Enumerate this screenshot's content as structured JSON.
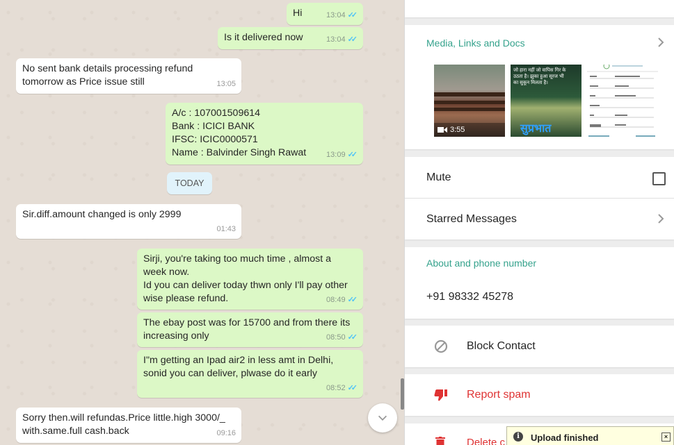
{
  "chat": {
    "messages": [
      {
        "dir": "out",
        "text": "Hi",
        "time": "13:04",
        "read": true
      },
      {
        "dir": "out",
        "text": "Is it delivered now",
        "time": "13:04",
        "read": true
      },
      {
        "dir": "in",
        "text": "No sent bank details processing refund\ntomorrow as Price issue still",
        "time": "13:05"
      },
      {
        "dir": "out",
        "text": "A/c : 107001509614\nBank : ICICI BANK\nIFSC:  ICIC0000571\nName : Balvinder Singh Rawat",
        "time": "13:09",
        "read": true
      },
      {
        "dir": "in",
        "text": "Sir.diff.amount changed is only 2999",
        "time": "01:43"
      },
      {
        "dir": "out",
        "text": "Sirji, you're taking too much time , almost a\nweek now.\nId you can deliver today thwn only I'll pay other\nwise please refund.",
        "time": "08:49",
        "read": true
      },
      {
        "dir": "out",
        "text": "The ebay post was for 15700 and from there its\nincreasing only",
        "time": "08:50",
        "read": true
      },
      {
        "dir": "out",
        "text": "I\"m getting an Ipad air2 in less amt in Delhi,\nsonid you can deliver, plwase do it early",
        "time": "08:52",
        "read": true
      },
      {
        "dir": "in",
        "text": "Sorry then.will refundas.Price little.high 3000/_\nwith.same.full cash.back",
        "time": "09:16"
      }
    ],
    "date_chip": "TODAY"
  },
  "info": {
    "media_title": "Media, Links and Docs",
    "video_duration": "3:55",
    "image2_text": "सुप्रभात",
    "image2_caption": "जो हारा नहीं जो वापिस गिर के\nउठता है। झुका हुआ सूरज भी\nका सुकून मिलता है।",
    "mute_label": "Mute",
    "starred_label": "Starred Messages",
    "about_title": "About and phone number",
    "phone": "+91 98332 45278",
    "block_label": "Block Contact",
    "report_label": "Report spam",
    "delete_label": "Delete c"
  },
  "upload_toast": "Upload finished",
  "colors": {
    "accent": "#35a28c",
    "danger": "#df3333",
    "outgoing_bubble": "#dcf8c6",
    "read_ticks": "#4fc3f7"
  }
}
